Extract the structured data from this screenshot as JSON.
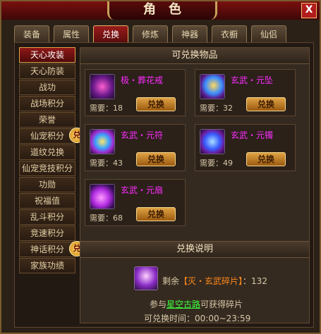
{
  "window": {
    "title": "角色",
    "close_glyph": "X"
  },
  "tabs": [
    {
      "label": "装备"
    },
    {
      "label": "属性"
    },
    {
      "label": "兑换",
      "active": true
    },
    {
      "label": "修炼"
    },
    {
      "label": "神器"
    },
    {
      "label": "衣橱"
    },
    {
      "label": "仙侣"
    }
  ],
  "sidebar": {
    "items": [
      {
        "label": "天心攻装",
        "active": true
      },
      {
        "label": "天心防装"
      },
      {
        "label": "战功"
      },
      {
        "label": "战场积分"
      },
      {
        "label": "荣誉"
      },
      {
        "label": "仙宠积分",
        "badge": "兑"
      },
      {
        "label": "道纹兑换"
      },
      {
        "label": "仙宠竞技积分"
      },
      {
        "label": "功勋"
      },
      {
        "label": "祝福值"
      },
      {
        "label": "乱斗积分"
      },
      {
        "label": "竞速积分"
      },
      {
        "label": "神话积分",
        "badge": "兑"
      },
      {
        "label": "家族功绩"
      }
    ]
  },
  "exchange": {
    "title": "可兑换物品",
    "need_label": "需要：",
    "button_label": "兑换",
    "items": [
      {
        "name": "极・葬花戒",
        "need": "18",
        "icon": "ring-icon",
        "color": "#ff2cff"
      },
      {
        "name": "玄武・元坠",
        "need": "32",
        "icon": "pendant-icon",
        "color": "#ff2cff"
      },
      {
        "name": "玄武・元符",
        "need": "43",
        "icon": "talisman-icon",
        "color": "#ff2cff"
      },
      {
        "name": "玄武・元镯",
        "need": "49",
        "icon": "bracelet-icon",
        "color": "#ff2cff"
      },
      {
        "name": "玄武・元扇",
        "need": "68",
        "icon": "fan-icon",
        "color": "#ff2cff"
      }
    ]
  },
  "info": {
    "title": "兑换说明",
    "remain_prefix": "剩余",
    "fragment_name": "【灭・玄武碎片】",
    "remain_sep": "：",
    "remain_value": "132",
    "join_prefix": "参与",
    "join_link": "星空古路",
    "join_suffix": "可获得碎片",
    "time_text": "可兑换时间：00:00~23:59"
  }
}
